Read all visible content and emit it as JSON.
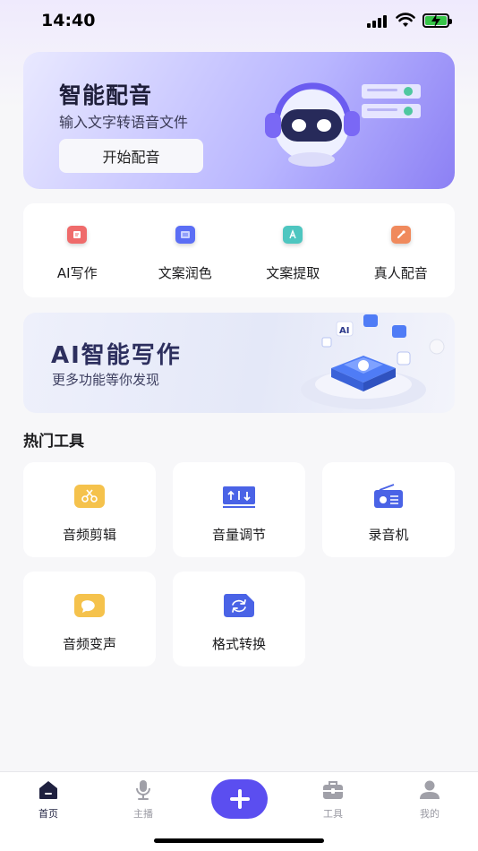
{
  "status_bar": {
    "time": "14:40"
  },
  "hero": {
    "title": "智能配音",
    "subtitle": "输入文字转语音文件",
    "button_label": "开始配音"
  },
  "quick_actions": [
    {
      "label": "AI写作",
      "icon": "ai-writing-icon",
      "color": "#ef6b6b"
    },
    {
      "label": "文案润色",
      "icon": "polish-icon",
      "color": "#5b6ef5"
    },
    {
      "label": "文案提取",
      "icon": "extract-icon",
      "color": "#4ec6c0"
    },
    {
      "label": "真人配音",
      "icon": "human-voice-icon",
      "color": "#f08a5d"
    }
  ],
  "ai_banner": {
    "title": "AI智能写作",
    "subtitle": "更多功能等你发现"
  },
  "hot_tools": {
    "title": "热门工具",
    "items": [
      {
        "label": "音频剪辑",
        "icon": "scissors-icon",
        "color": "#f5c24c"
      },
      {
        "label": "音量调节",
        "icon": "volume-adjust-icon",
        "color": "#4a63e6"
      },
      {
        "label": "录音机",
        "icon": "radio-icon",
        "color": "#4a63e6"
      },
      {
        "label": "音频变声",
        "icon": "voice-change-icon",
        "color": "#f5c24c"
      },
      {
        "label": "格式转换",
        "icon": "convert-icon",
        "color": "#4a63e6"
      }
    ]
  },
  "tab_bar": {
    "tabs": [
      {
        "label": "首页",
        "icon": "home-icon",
        "active": true
      },
      {
        "label": "主播",
        "icon": "microphone-icon",
        "active": false
      },
      {
        "label": "工具",
        "icon": "toolbox-icon",
        "active": false
      },
      {
        "label": "我的",
        "icon": "profile-icon",
        "active": false
      }
    ],
    "add_icon": "plus-icon"
  },
  "colors": {
    "accent": "#5b4ef0",
    "background": "#f7f7f9"
  }
}
